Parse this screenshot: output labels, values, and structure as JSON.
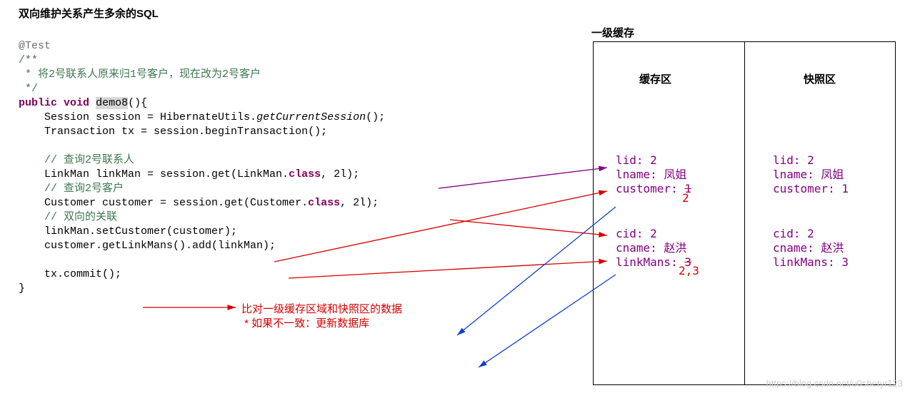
{
  "title": "双向维护关系产生多余的SQL",
  "code": {
    "anno": "@Test",
    "comm_open": "/**",
    "comm_line": " * 将2号联系人原来归1号客户，现在改为2号客户",
    "comm_close": " */",
    "kw_public": "public",
    "kw_void": "void",
    "method": "demo8",
    "line1a": "    Session session = HibernateUtils.",
    "line1b_it": "getCurrentSession",
    "line1c": "();",
    "line2": "    Transaction tx = session.beginTransaction();",
    "comm1": "    // 查询2号联系人",
    "line3a": "    LinkMan linkMan = session.get(LinkMan.",
    "kw_class1": "class",
    "line3b": ", 2l);",
    "comm2": "    // 查询2号客户",
    "line4a": "    Customer customer = session.get(Customer.",
    "kw_class2": "class",
    "line4b": ", 2l);",
    "comm3": "    // 双向的关联",
    "line5": "    linkMan.setCustomer(customer);",
    "line6": "    customer.getLinkMans().add(linkMan);",
    "line7": "    tx.commit();",
    "brace_close": "}"
  },
  "diagram": {
    "title": "一级缓存",
    "col_left": "缓存区",
    "col_right": "快照区",
    "cache1_l1": "lid: 2",
    "cache1_l2": "lname: 凤姐",
    "cache1_l3a": "customer: ",
    "cache1_l3b_struck": "1",
    "cache1_new": "2",
    "snap1_l1": "lid: 2",
    "snap1_l2": "lname: 凤姐",
    "snap1_l3": "customer: 1",
    "cache2_l1": "cid: 2",
    "cache2_l2": "cname: 赵洪",
    "cache2_l3a": "linkMans: ",
    "cache2_l3b_struck": "3",
    "cache2_new": "2,3",
    "snap2_l1": "cid: 2",
    "snap2_l2": "cname: 赵洪",
    "snap2_l3": "linkMans: 3"
  },
  "red_note": {
    "l1": "比对一级缓存区域和快照区的数据",
    "l2": " * 如果不一致：更新数据库"
  },
  "watermark": "https://blog.csdn.net/u0shetyr123"
}
